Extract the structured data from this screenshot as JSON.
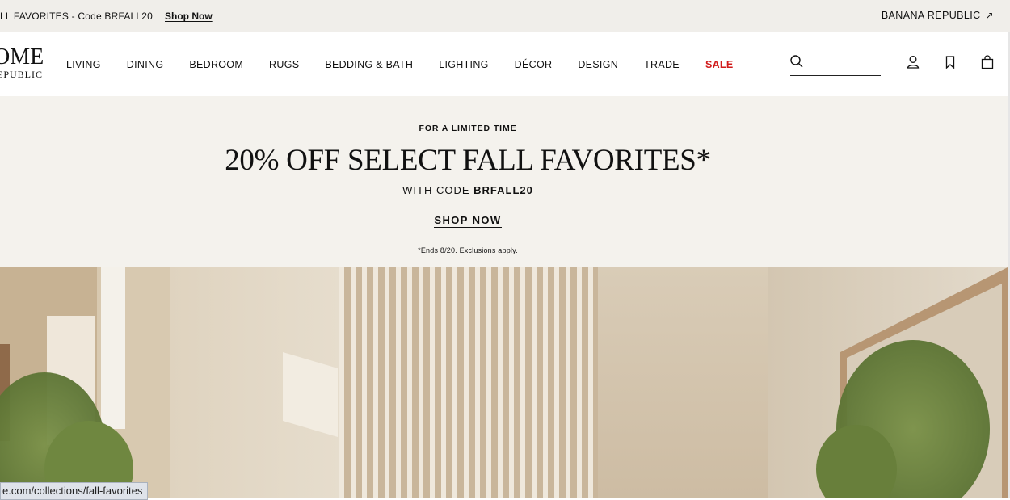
{
  "topbar": {
    "promo_text": "LL FAVORITES - Code BRFALL20",
    "promo_link": "Shop Now",
    "brand_link": "BANANA REPUBLIC",
    "brand_arrow": "↗"
  },
  "nav": {
    "logo_line1": "OME",
    "logo_line2": "EPUBLIC",
    "links": [
      "LIVING",
      "DINING",
      "BEDROOM",
      "RUGS",
      "BEDDING & BATH",
      "LIGHTING",
      "DÉCOR",
      "DESIGN",
      "TRADE"
    ],
    "sale": "SALE",
    "search_value": "",
    "icons": [
      "search-icon",
      "account-icon",
      "bookmark-icon",
      "bag-icon"
    ]
  },
  "hero": {
    "eyebrow": "FOR A LIMITED TIME",
    "headline": "20% OFF SELECT FALL FAVORITES*",
    "code_prefix": "WITH CODE",
    "code": "BRFALL20",
    "cta": "SHOP NOW",
    "fine_print": "*Ends 8/20. Exclusions apply."
  },
  "status_bar": {
    "url": "e.com/collections/fall-favorites"
  },
  "colors": {
    "topbar_bg": "#f0eeea",
    "hero_bg": "#f4f2ed",
    "sale_red": "#d11a1a"
  }
}
